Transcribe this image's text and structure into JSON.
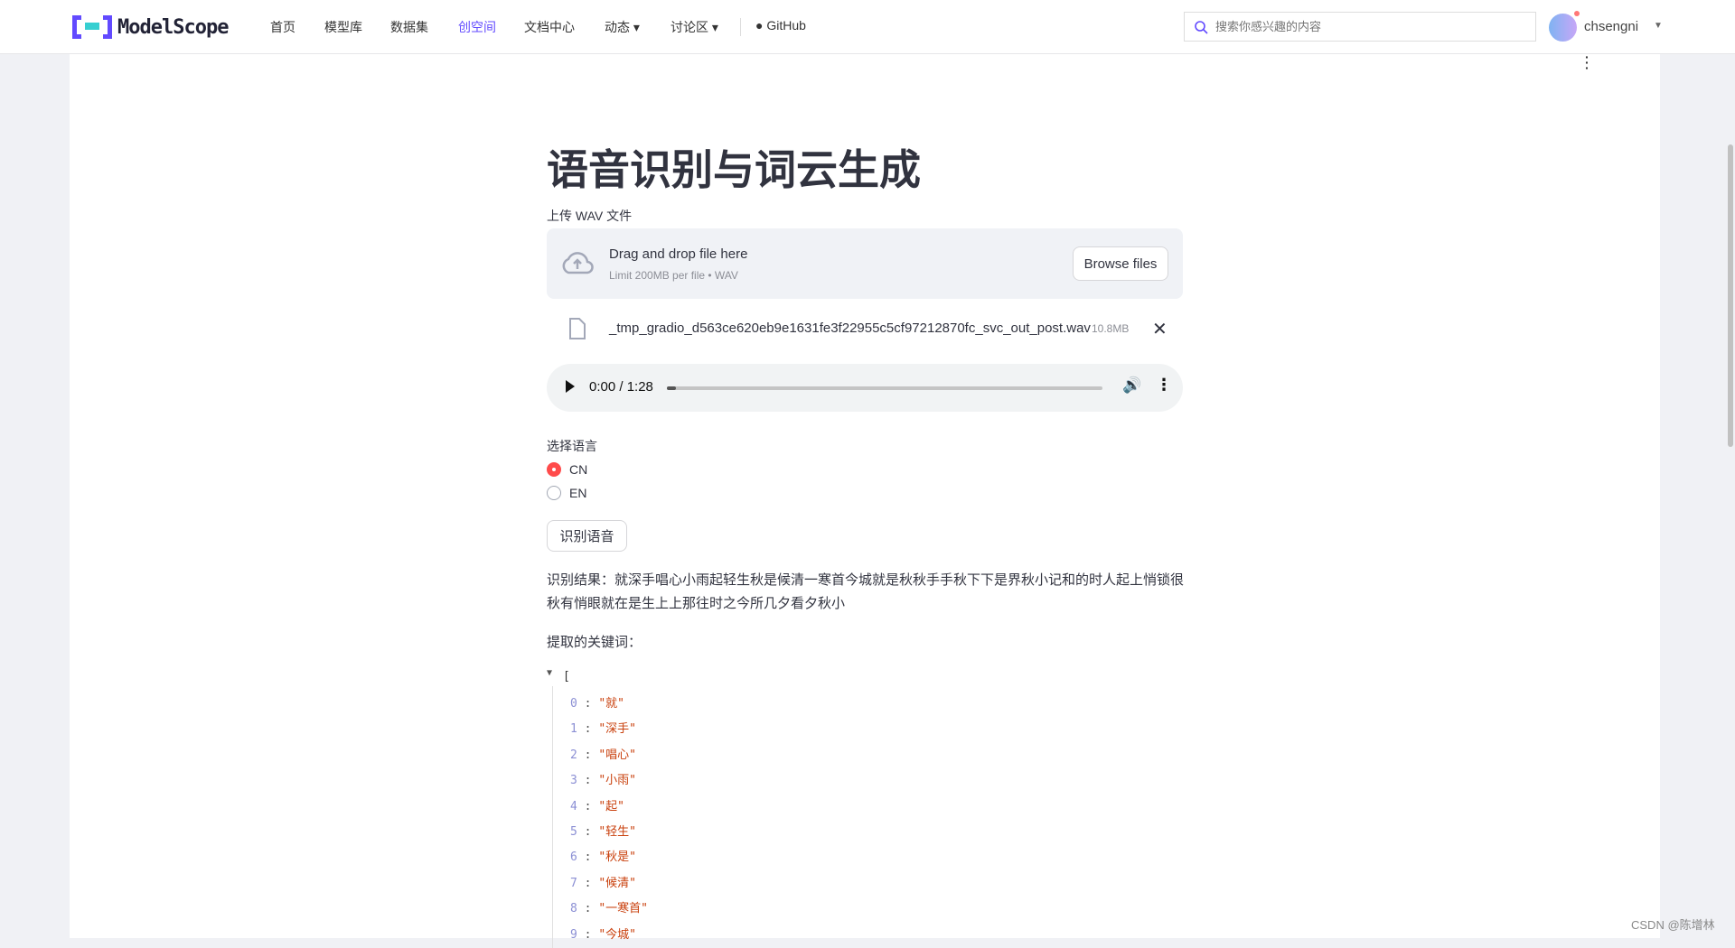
{
  "header": {
    "logo_text": "ModelScope",
    "nav": [
      {
        "label": "首页",
        "active": false
      },
      {
        "label": "模型库",
        "active": false
      },
      {
        "label": "数据集",
        "active": false
      },
      {
        "label": "创空间",
        "active": true
      },
      {
        "label": "文档中心",
        "active": false
      },
      {
        "label": "动态 ▾",
        "active": false
      },
      {
        "label": "讨论区 ▾",
        "active": false
      }
    ],
    "github": "GitHub",
    "search_placeholder": "搜索你感兴趣的内容",
    "username": "chsengni",
    "accent": "#624aff"
  },
  "main": {
    "title": "语音识别与词云生成",
    "upload_label": "上传 WAV 文件",
    "drop_text": "Drag and drop file here",
    "drop_limit": "Limit 200MB per file • WAV",
    "browse": "Browse files",
    "file_name": "_tmp_gradio_d563ce620eb9e1631fe3f22955c5cf97212870fc_svc_out_post.wav",
    "file_size": "10.8MB",
    "audio_time": "0:00 / 1:28",
    "audio_progress": 0.02,
    "lang_label": "选择语言",
    "lang_options": [
      "CN",
      "EN"
    ],
    "lang_selected": "CN",
    "recognize_button": "识别语音",
    "result": "识别结果：就深手唱心小雨起轻生秋是候清一寒首今城就是秋秋手手秋下下是界秋小记和的时人起上悄锁很秋有悄眼就在是生上上那往时之今所几夕看夕秋小",
    "keywords_label": "提取的关键词：",
    "keywords": [
      "就",
      "深手",
      "唱心",
      "小雨",
      "起",
      "轻生",
      "秋是",
      "候清",
      "一寒首",
      "今城"
    ]
  },
  "watermark": "CSDN @陈增林"
}
